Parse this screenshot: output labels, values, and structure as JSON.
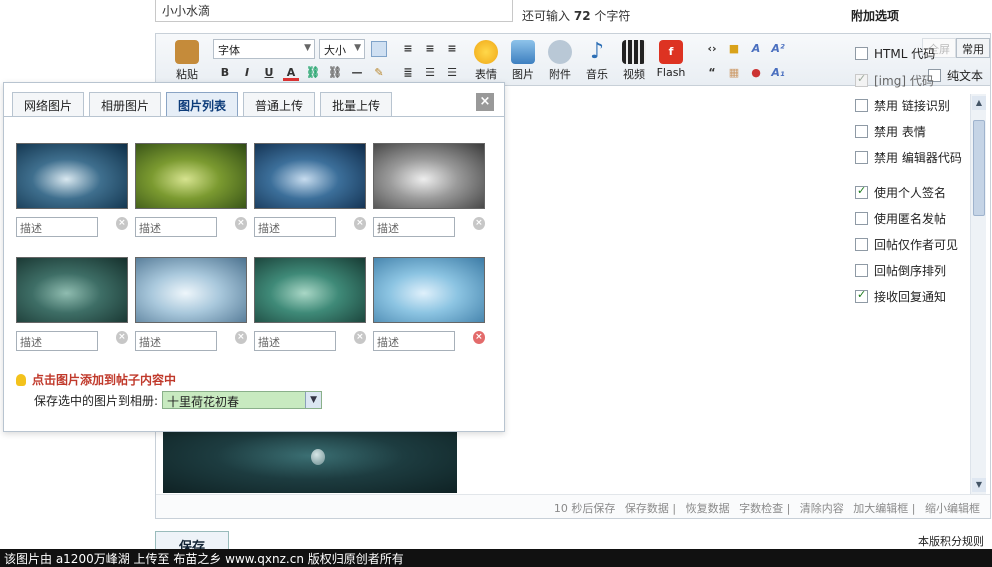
{
  "title_field": {
    "value": "小小水滴"
  },
  "char_counter": {
    "prefix": "还可输入",
    "count": "72",
    "suffix": "个字符"
  },
  "toolbar": {
    "paste": "粘贴",
    "font": "字体",
    "size": "大小",
    "bold": "B",
    "italic": "I",
    "underline": "U",
    "color": "A",
    "emoticon": "表情",
    "image": "图片",
    "attachment": "附件",
    "music": "音乐",
    "video": "视频",
    "flash": "Flash"
  },
  "mode": {
    "fullscreen": "全屏",
    "common": "常用",
    "plain_text": "纯文本"
  },
  "options": {
    "title": "附加选项",
    "items": [
      {
        "label": "HTML 代码",
        "checked": false,
        "disabled": false
      },
      {
        "label": "[img] 代码",
        "checked": true,
        "disabled": true
      },
      {
        "label": "禁用 链接识别",
        "checked": false,
        "disabled": false
      },
      {
        "label": "禁用 表情",
        "checked": false,
        "disabled": false
      },
      {
        "label": "禁用 编辑器代码",
        "checked": false,
        "disabled": false
      },
      {
        "label": "使用个人签名",
        "checked": true,
        "disabled": false
      },
      {
        "label": "使用匿名发帖",
        "checked": false,
        "disabled": false
      },
      {
        "label": "回帖仅作者可见",
        "checked": false,
        "disabled": false
      },
      {
        "label": "回帖倒序排列",
        "checked": false,
        "disabled": false
      },
      {
        "label": "接收回复通知",
        "checked": true,
        "disabled": false
      }
    ]
  },
  "popup": {
    "tabs": [
      "网络图片",
      "相册图片",
      "图片列表",
      "普通上传",
      "批量上传"
    ],
    "active_tab": 2,
    "close": "×",
    "desc_placeholder": "描述",
    "tip": "点击图片添加到帖子内容中",
    "save_label": "保存选中的图片到相册:",
    "album": "十里荷花初春",
    "thumbs": [
      {
        "colors": [
          "#d9e8f0",
          "#3f6f8e",
          "#0e2f48"
        ]
      },
      {
        "colors": [
          "#d6e38f",
          "#7b9a30",
          "#2f4a14"
        ]
      },
      {
        "colors": [
          "#c7dcef",
          "#3c6f9a",
          "#0f2b4a"
        ]
      },
      {
        "colors": [
          "#eeeeee",
          "#9a9a9a",
          "#3b3b3b"
        ]
      },
      {
        "colors": [
          "#8fbcb0",
          "#3e6e66",
          "#15302c"
        ]
      },
      {
        "colors": [
          "#eef6fb",
          "#a9c8dc",
          "#4d7390"
        ]
      },
      {
        "colors": [
          "#a9d7c6",
          "#3f8a78",
          "#173b34"
        ]
      },
      {
        "colors": [
          "#dff0fb",
          "#8cc4e2",
          "#3d7ca6"
        ]
      }
    ]
  },
  "editor_footer": {
    "autosave": "10 秒后保存",
    "save_data": "保存数据",
    "restore": "恢复数据",
    "word_check": "字数检查",
    "clear": "清除内容",
    "enlarge": "加大编辑框",
    "shrink": "缩小编辑框"
  },
  "save_button": "保存",
  "rules_link": "本版积分规则",
  "watermark": "该图片由 a1200万峰湖 上传至 布苗之乡 www.qxnz.cn 版权归原创者所有"
}
